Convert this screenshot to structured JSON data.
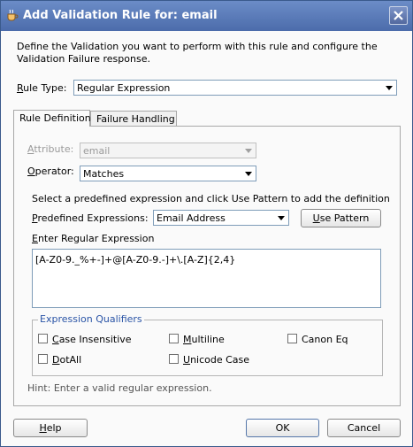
{
  "window": {
    "title": "Add Validation Rule for: email"
  },
  "description": "Define the Validation you want to perform with this rule and configure the Validation Failure response.",
  "rule_type": {
    "label_u": "R",
    "label_rest": "ule Type:",
    "value": "Regular Expression"
  },
  "tabs": [
    {
      "label": "Rule Definition"
    },
    {
      "label": "Failure Handling"
    }
  ],
  "attribute": {
    "label_u": "A",
    "label_rest": "ttribute:",
    "value": "email"
  },
  "operator": {
    "label_u": "O",
    "label_rest": "perator:",
    "value": "Matches"
  },
  "instruction": "Select a predefined expression and click Use Pattern to add the definition",
  "predefined": {
    "label_u": "P",
    "label_rest": "redefined Expressions:",
    "value": "Email Address",
    "button_u": "U",
    "button_rest": "se Pattern"
  },
  "regex": {
    "label_u": "E",
    "label_rest": "nter Regular Expression",
    "value": "[A-Z0-9._%+-]+@[A-Z0-9.-]+\\.[A-Z]{2,4}"
  },
  "qualifiers": {
    "legend": "Expression Qualifiers",
    "items": [
      {
        "u": "C",
        "rest": "ase Insensitive",
        "checked": false
      },
      {
        "u": "M",
        "rest": "ultiline",
        "checked": false
      },
      {
        "u": "",
        "rest": "Canon Eq",
        "checked": false
      },
      {
        "u": "D",
        "rest": "otAll",
        "checked": false
      },
      {
        "u": "U",
        "rest": "nicode Case",
        "checked": false
      }
    ]
  },
  "hint": "Hint: Enter a valid regular expression.",
  "buttons": {
    "help_u": "H",
    "help_rest": "elp",
    "ok": "OK",
    "cancel": "Cancel"
  },
  "colors": {
    "title_bar": "#4c6cab",
    "legend": "#2a54a6"
  },
  "icons": {
    "app": "coffee-cup-icon",
    "close": "close-icon"
  }
}
